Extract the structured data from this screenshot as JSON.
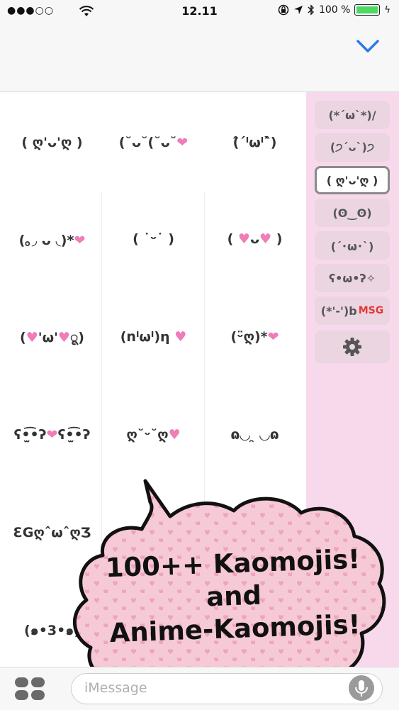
{
  "status_bar": {
    "signal": "●●●○○",
    "time": "12.11",
    "battery_percent": "100 %"
  },
  "header": {
    "collapse_icon": "chevron-down-icon"
  },
  "kaomoji_grid": {
    "r1c1": "( ღ'ᴗ'ღ )",
    "r1c2": "(˘ᴗ˘(˘ᴗ˘❤",
    "r1c3": "(̂ˊᴵωᴵˋ̂)",
    "r2c1": "(｡◞ ᴗ ◟)*❤",
    "r2c2": "( ˙ᵕ˙ )",
    "r2c3": "( ♥ᴗ♥ )",
    "r3c1": "(♥'ω'♥ू)",
    "r3c2": "(nᴵωᴵ)η ♥",
    "r3c3": "(ᵕ̈ღ)*❤",
    "r4c1": "ʕ•̫͡•ʔ❤ʕ•̫͡•ʔ",
    "r4c2": "ღ˘ᵕ˘ღ♥",
    "r4c3": "ɷ◡ ̯ ◡ɷ",
    "r5c1": "ƐGღˆωˆღƷ",
    "r6c1": "(๑•3•๑)"
  },
  "sidebar": {
    "categories": [
      "(*ˊωˋ*)/",
      "(੭ˊᴗˋ)੭",
      "( ღ'ᴗ'ღ )",
      "(ʘ‿ʘ)",
      "(´･ω･`)",
      "ʕ•ω•ʔ✧",
      "(*'-')b",
      "MSG"
    ],
    "settings_icon": "gear-icon"
  },
  "promo": {
    "line1": "100++ Kaomojis!",
    "line2": "and",
    "line3": "Anime-Kaomojis!"
  },
  "bottom_bar": {
    "apps_icon": "app-drawer-icon",
    "input_placeholder": "iMessage",
    "mic_icon": "microphone-icon"
  }
}
